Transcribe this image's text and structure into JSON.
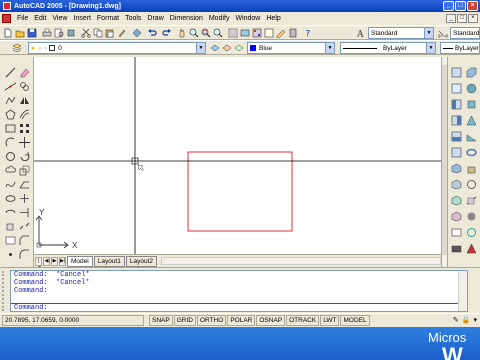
{
  "window": {
    "title": "AutoCAD 2005 - [Drawing1.dwg]",
    "controls": [
      "_",
      "□",
      "×"
    ]
  },
  "menubar": {
    "items": [
      "File",
      "Edit",
      "View",
      "Insert",
      "Format",
      "Tools",
      "Draw",
      "Dimension",
      "Modify",
      "Window",
      "Help"
    ],
    "mdi_controls": [
      "_",
      "□",
      "×"
    ]
  },
  "styles_toolbar": {
    "text_style": "Standard",
    "dim_style": "Standard"
  },
  "layers_toolbar": {
    "current_layer": "0",
    "color": "Blue",
    "color_hex": "#0000ff",
    "linetype": "ByLayer",
    "lineweight": "ByLayer"
  },
  "drawing": {
    "ucs_x_label": "X",
    "ucs_y_label": "Y",
    "rectangle_color": "#e0303a",
    "crosshair_color": "#000000"
  },
  "layout_tabs": {
    "nav": [
      "|◀",
      "◀",
      "▶",
      "▶|"
    ],
    "tabs": [
      {
        "label": "Model",
        "active": true
      },
      {
        "label": "Layout1",
        "active": false
      },
      {
        "label": "Layout2",
        "active": false
      }
    ]
  },
  "command": {
    "history": [
      "Command:  *Cancel*",
      "Command:  *Cancel*",
      "Command:"
    ],
    "prompt": "Command:"
  },
  "status": {
    "coordinates": "20.7895, 17.0659, 0.0000",
    "toggles": [
      "SNAP",
      "GRID",
      "ORTHO",
      "POLAR",
      "OSNAP",
      "OTRACK",
      "LWT",
      "MODEL"
    ]
  },
  "desktop": {
    "brand_line1": "Micros",
    "brand_line2": "W"
  }
}
